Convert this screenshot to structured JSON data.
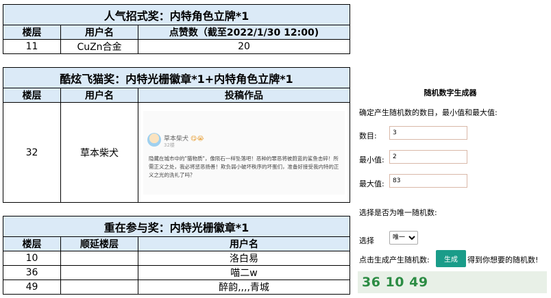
{
  "popular": {
    "title": "人气招式奖：内特角色立牌*1",
    "headers": [
      "楼层",
      "用户名",
      "点赞数（截至2022/1/30 12:00)"
    ],
    "row": {
      "floor": "11",
      "user": "CuZn合金",
      "likes": "20"
    }
  },
  "cool": {
    "title": "酷炫飞猫奖：内特光栅徽章*1+内特角色立牌*1",
    "headers": [
      "楼层",
      "用户名",
      "投稿作品"
    ],
    "row": {
      "floor": "32",
      "user": "草本柴犬"
    },
    "post": {
      "author": "草本柴犬",
      "emoji": "😋😭",
      "floor": "32楼",
      "text": "隐藏在城市中的\"猫物质\"，像陨石一样坠落吧！恶种的罪恶将被蔚蓝的鲨鱼击碎！所需正义之处，我必将惩恶扬善！欺负弱小破坏秩序的坏蛋们，准备好接受我内特的正义之光的洗礼了吗？"
    }
  },
  "participation": {
    "title": "重在参与奖：内特光栅徽章*1",
    "headers": [
      "楼层",
      "顺延楼层",
      "用户名"
    ],
    "rows": [
      {
        "floor": "10",
        "next": "",
        "user": "洛白易"
      },
      {
        "floor": "36",
        "next": "",
        "user": "喵二w"
      },
      {
        "floor": "49",
        "next": "",
        "user": "醉韵,,,,青城"
      }
    ]
  },
  "generator": {
    "title": "随机数字生成器",
    "description": "确定产生随机数的数目，最小值和最大值:",
    "count_label": "数目:",
    "count_value": "3",
    "min_label": "最小值:",
    "min_value": "2",
    "max_label": "最大值:",
    "max_value": "83",
    "unique_label": "选择是否为唯一随机数:",
    "select_label": "选择",
    "select_value": "唯一",
    "action_label": "点击生成产生随机数:",
    "button_label": "生成",
    "after_label": "得到你想要的随机数!",
    "result": "36 10 49"
  }
}
